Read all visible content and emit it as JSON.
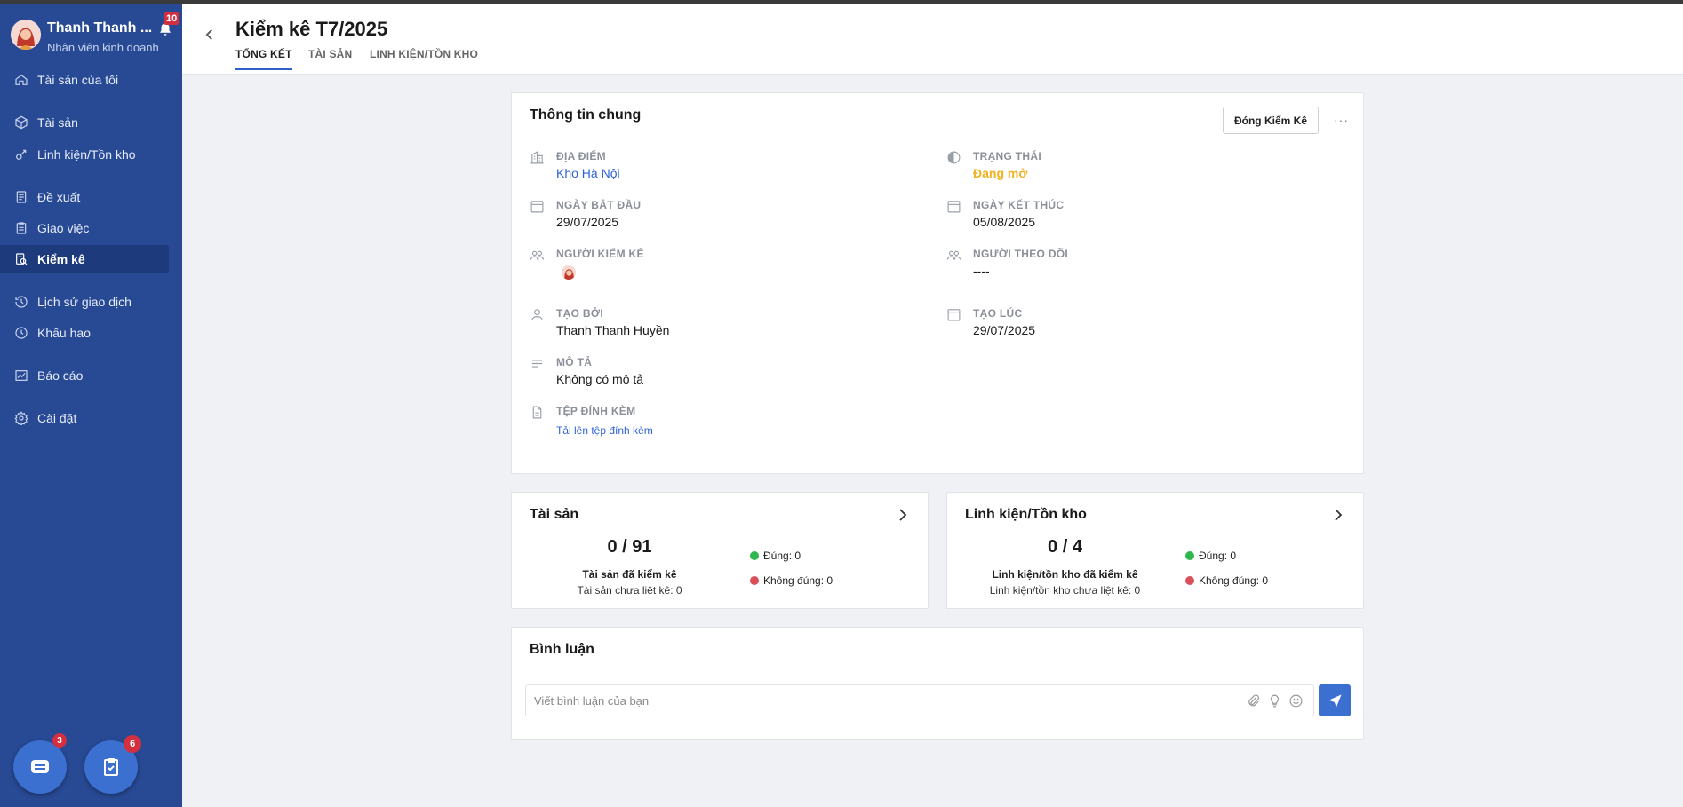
{
  "user": {
    "name": "Thanh Thanh ...",
    "role": "Nhân viên kinh doanh",
    "notification_count": "10"
  },
  "nav": {
    "items": [
      {
        "label": "Tài sản của tôi",
        "icon": "home-icon"
      },
      {
        "label": "Tài sản",
        "icon": "box-icon"
      },
      {
        "label": "Linh kiện/Tồn kho",
        "icon": "components-icon"
      },
      {
        "label": "Đề xuất",
        "icon": "document-icon"
      },
      {
        "label": "Giao việc",
        "icon": "clipboard-icon"
      },
      {
        "label": "Kiểm kê",
        "icon": "inventory-check-icon",
        "active": true
      },
      {
        "label": "Lịch sử giao dịch",
        "icon": "history-icon"
      },
      {
        "label": "Khấu hao",
        "icon": "clock-icon"
      },
      {
        "label": "Báo cáo",
        "icon": "chart-icon"
      },
      {
        "label": "Cài đặt",
        "icon": "gear-icon"
      }
    ]
  },
  "fab": {
    "chat_badge": "3",
    "tasks_badge": "6"
  },
  "header": {
    "title": "Kiểm kê T7/2025",
    "tabs": [
      "TỔNG KẾT",
      "TÀI SẢN",
      "LINH KIỆN/TỒN KHO"
    ],
    "active_tab": "TỔNG KẾT"
  },
  "general": {
    "title": "Thông tin chung",
    "close_button": "Đóng Kiểm Kê",
    "more": "···",
    "location_label": "ĐỊA ĐIỂM",
    "location_value": "Kho Hà Nội",
    "status_label": "TRẠNG THÁI",
    "status_value": "Đang mở",
    "start_label": "NGÀY BẮT ĐẦU",
    "start_value": "29/07/2025",
    "end_label": "NGÀY KẾT THÚC",
    "end_value": "05/08/2025",
    "checker_label": "NGƯỜI KIỂM KÊ",
    "follower_label": "NGƯỜI THEO DÕI",
    "follower_value": "----",
    "created_by_label": "TẠO BỞI",
    "created_by_value": "Thanh Thanh Huyền",
    "created_at_label": "TẠO LÚC",
    "created_at_value": "29/07/2025",
    "desc_label": "MÔ TẢ",
    "desc_value": "Không có mô tả",
    "attach_label": "TỆP ĐÍNH KÈM",
    "attach_link": "Tải lên tệp đính kèm"
  },
  "assets": {
    "title": "Tài sản",
    "count": "0 / 91",
    "count_label": "Tài sản đã kiểm kê",
    "unlisted": "Tài sản chưa liệt kê: 0",
    "correct": "Đúng: 0",
    "incorrect": "Không đúng: 0"
  },
  "components": {
    "title": "Linh kiện/Tồn kho",
    "count": "0 / 4",
    "count_label": "Linh kiện/tồn kho đã kiểm kê",
    "unlisted": "Linh kiện/tồn kho chưa liệt kê: 0",
    "correct": "Đúng: 0",
    "incorrect": "Không đúng: 0"
  },
  "comments": {
    "title": "Bình luận",
    "placeholder": "Viết bình luận của bạn"
  },
  "colors": {
    "sidebar": "#284a95",
    "accent": "#3b6fd0",
    "status_open": "#f0b323",
    "correct": "#2db84d",
    "incorrect": "#d9505a"
  }
}
